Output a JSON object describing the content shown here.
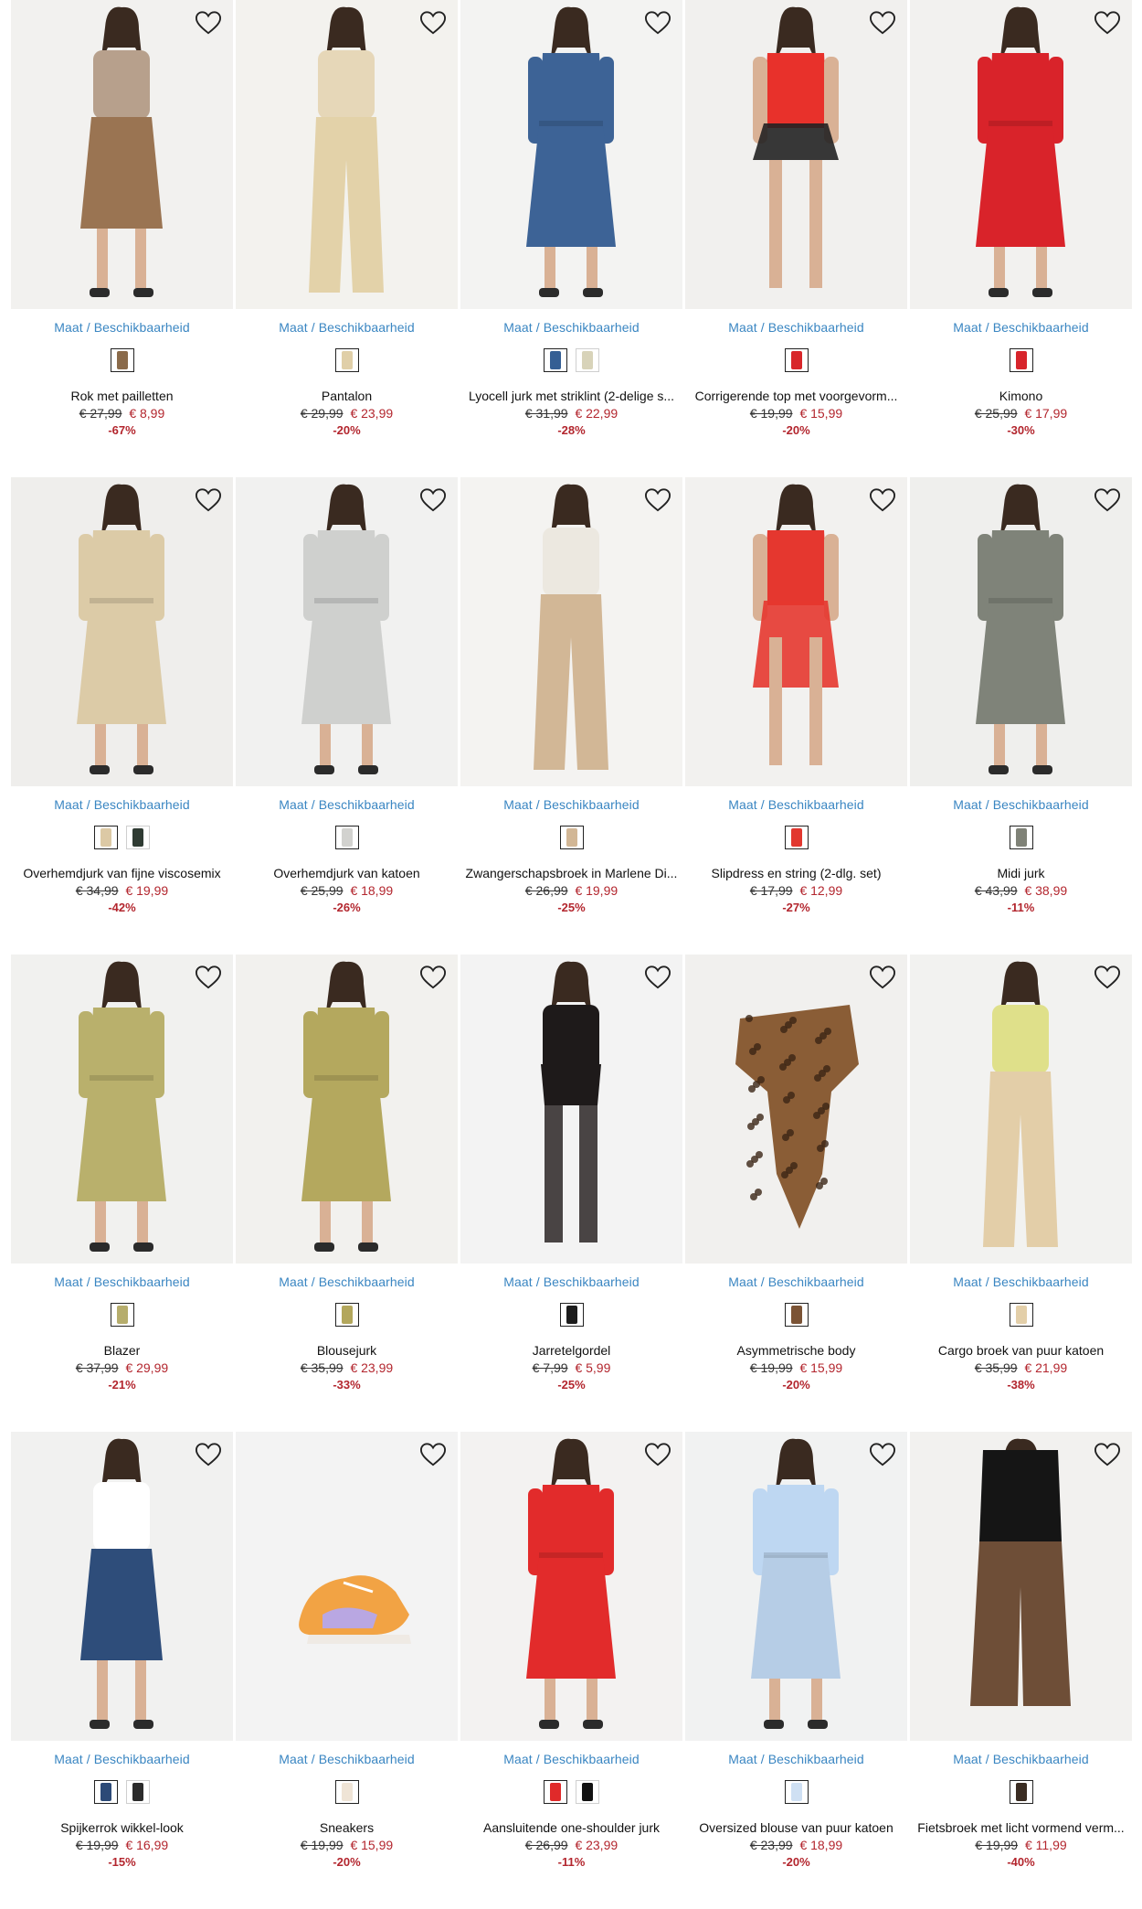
{
  "availability_label": "Maat / Beschikbaarheid",
  "products": [
    {
      "name": "Rok met pailletten",
      "old_price": "€ 27,99",
      "new_price": "€ 8,99",
      "discount": "-67%",
      "colors": [
        "#8a6a4a"
      ],
      "garment": "skirt",
      "top": "#b7a08c",
      "bottom": "#9a7452",
      "bg": "#f2f1ef"
    },
    {
      "name": "Pantalon",
      "old_price": "€ 29,99",
      "new_price": "€ 23,99",
      "discount": "-20%",
      "colors": [
        "#e0cfa8"
      ],
      "garment": "pants",
      "top": "#e6d7b8",
      "bottom": "#e3d2a9",
      "bg": "#f3f2ee"
    },
    {
      "name": "Lyocell jurk met striklint (2-delige s...",
      "old_price": "€ 31,99",
      "new_price": "€ 22,99",
      "discount": "-28%",
      "colors": [
        "#355f94",
        "#d8d3b9"
      ],
      "garment": "dress",
      "top": "#3d6396",
      "bottom": "#3d6396",
      "bg": "#f3f3f2"
    },
    {
      "name": "Corrigerende top met voorgevorm...",
      "old_price": "€ 19,99",
      "new_price": "€ 15,99",
      "discount": "-20%",
      "colors": [
        "#d8262a"
      ],
      "garment": "lingerie",
      "top": "#e8312b",
      "bottom": "#222222",
      "bg": "#f1f0ee"
    },
    {
      "name": "Kimono",
      "old_price": "€ 25,99",
      "new_price": "€ 17,99",
      "discount": "-30%",
      "colors": [
        "#d7242b"
      ],
      "garment": "robe",
      "top": "#d9232a",
      "bottom": "#d9232a",
      "bg": "#f2f1ef"
    },
    {
      "name": "Overhemdjurk van fijne viscosemix",
      "old_price": "€ 34,99",
      "new_price": "€ 19,99",
      "discount": "-42%",
      "colors": [
        "#dcc9a5",
        "#2f3b33"
      ],
      "garment": "dress",
      "top": "#dccba7",
      "bottom": "#dccba7",
      "bg": "#efeeec"
    },
    {
      "name": "Overhemdjurk van katoen",
      "old_price": "€ 25,99",
      "new_price": "€ 18,99",
      "discount": "-26%",
      "colors": [
        "#d2d2cf"
      ],
      "garment": "dress",
      "top": "#cfd0ce",
      "bottom": "#cfd0ce",
      "bg": "#f1f1f0"
    },
    {
      "name": "Zwangerschapsbroek in Marlene Di...",
      "old_price": "€ 26,99",
      "new_price": "€ 19,99",
      "discount": "-25%",
      "colors": [
        "#d2b796"
      ],
      "garment": "pants",
      "top": "#ece8e0",
      "bottom": "#d2b796",
      "bg": "#f4f3f1"
    },
    {
      "name": "Slipdress en string (2-dlg. set)",
      "old_price": "€ 17,99",
      "new_price": "€ 12,99",
      "discount": "-27%",
      "colors": [
        "#e2372f"
      ],
      "garment": "slip",
      "top": "#e5372f",
      "bottom": "#e5372f",
      "bg": "#f2f1ef"
    },
    {
      "name": "Midi jurk",
      "old_price": "€ 43,99",
      "new_price": "€ 38,99",
      "discount": "-11%",
      "colors": [
        "#7f8277"
      ],
      "garment": "dress",
      "top": "#7f8379",
      "bottom": "#7f8379",
      "bg": "#efefed"
    },
    {
      "name": "Blazer",
      "old_price": "€ 37,99",
      "new_price": "€ 29,99",
      "discount": "-21%",
      "colors": [
        "#b6ad6c"
      ],
      "garment": "blazer",
      "top": "#b9b06c",
      "bottom": "#b9b06c",
      "bg": "#f1f1ef"
    },
    {
      "name": "Blousejurk",
      "old_price": "€ 35,99",
      "new_price": "€ 23,99",
      "discount": "-33%",
      "colors": [
        "#b3a75c"
      ],
      "garment": "dress",
      "top": "#b4a85e",
      "bottom": "#b4a85e",
      "bg": "#f2f1ee"
    },
    {
      "name": "Jarretelgordel",
      "old_price": "€ 7,99",
      "new_price": "€ 5,99",
      "discount": "-25%",
      "colors": [
        "#1c1c1c"
      ],
      "garment": "garter",
      "top": "#1e1a1a",
      "bottom": "#2a2525",
      "bg": "#f3f3f3"
    },
    {
      "name": "Asymmetrische body",
      "old_price": "€ 19,99",
      "new_price": "€ 15,99",
      "discount": "-20%",
      "colors": [
        "#7b5335"
      ],
      "garment": "body",
      "top": "#8a5d36",
      "bottom": "#8a5d36",
      "bg": "#f1f0ee"
    },
    {
      "name": "Cargo broek van puur katoen",
      "old_price": "€ 35,99",
      "new_price": "€ 21,99",
      "discount": "-38%",
      "colors": [
        "#e3cfa9"
      ],
      "garment": "cargo",
      "top": "#dfe08a",
      "bottom": "#e3cea8",
      "bg": "#f2f2f0"
    },
    {
      "name": "Spijkerrok wikkel-look",
      "old_price": "€ 19,99",
      "new_price": "€ 16,99",
      "discount": "-15%",
      "colors": [
        "#2c4a77",
        "#2b2b2b"
      ],
      "garment": "skirt",
      "top": "#ffffff",
      "bottom": "#2e4d7a",
      "bg": "#f1f1f0"
    },
    {
      "name": "Sneakers",
      "old_price": "€ 19,99",
      "new_price": "€ 15,99",
      "discount": "-20%",
      "colors": [
        "#efe4d6"
      ],
      "garment": "sneaker",
      "top": "#f2a344",
      "bottom": "#b9a7e2",
      "bg": "#f3f3f3"
    },
    {
      "name": "Aansluitende one-shoulder jurk",
      "old_price": "€ 26,99",
      "new_price": "€ 23,99",
      "discount": "-11%",
      "colors": [
        "#e02a2a",
        "#111111"
      ],
      "garment": "dress",
      "top": "#e22b2b",
      "bottom": "#e22b2b",
      "bg": "#f3f2f1"
    },
    {
      "name": "Oversized blouse van puur katoen",
      "old_price": "€ 23,99",
      "new_price": "€ 18,99",
      "discount": "-20%",
      "colors": [
        "#cfe0f3"
      ],
      "garment": "blouse",
      "top": "#bed7f2",
      "bottom": "#b6cde6",
      "bg": "#f1f2f2"
    },
    {
      "name": "Fietsbroek met licht vormend verm...",
      "old_price": "€ 19,99",
      "new_price": "€ 11,99",
      "discount": "-40%",
      "colors": [
        "#3a2c22"
      ],
      "garment": "shorts",
      "top": "#151515",
      "bottom": "#6e4e37",
      "bg": "#f2f1ef"
    }
  ]
}
